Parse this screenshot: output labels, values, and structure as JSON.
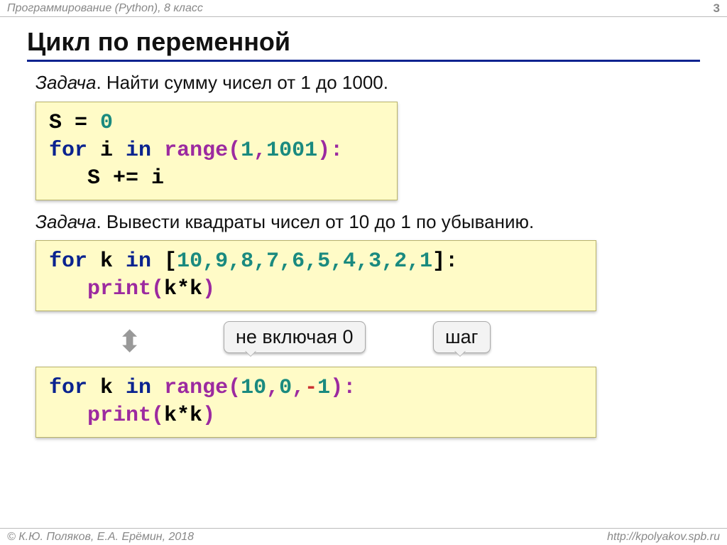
{
  "header": {
    "course": "Программирование (Python), 8 класс",
    "page": "3"
  },
  "title": "Цикл по переменной",
  "task1": {
    "label": "Задача",
    "text": ". Найти сумму чисел от 1 до 1000."
  },
  "code1": {
    "l1a": "S = ",
    "l1_zero": "0",
    "l2_for": "for",
    "l2_var": " i ",
    "l2_in": "in",
    "l2_sp": " ",
    "l2_range": "range(",
    "l2_n1": "1",
    "l2_c": ",",
    "l2_n2": "1001",
    "l2_close": "):",
    "l3": "   S += i"
  },
  "task2": {
    "label": "Задача",
    "text": ". Вывести квадраты чисел от 10 до 1 по убыванию."
  },
  "code2": {
    "l1_for": "for",
    "l1_var": " k ",
    "l1_in": "in",
    "l1_sp": " [",
    "nums": "10,9,8,7,6,5,4,3,2,1",
    "l1_close": "]:",
    "l2_ind": "   ",
    "l2_print": "print(",
    "l2_arg": "k*k",
    "l2_close": ")"
  },
  "callouts": {
    "c1": "не включая 0",
    "c2": "шаг"
  },
  "code3": {
    "l1_for": "for",
    "l1_var": " k ",
    "l1_in": "in",
    "l1_sp": " ",
    "l1_range": "range(",
    "n1": "10",
    "c1": ",",
    "n2": "0",
    "c2": ",",
    "neg": "-",
    "n3": "1",
    "l1_close": "):",
    "l2_ind": "   ",
    "l2_print": "print(",
    "l2_arg": "k*k",
    "l2_close": ")"
  },
  "footer": {
    "left": "© К.Ю. Поляков, Е.А. Ерёмин, 2018",
    "right": "http://kpolyakov.spb.ru"
  }
}
